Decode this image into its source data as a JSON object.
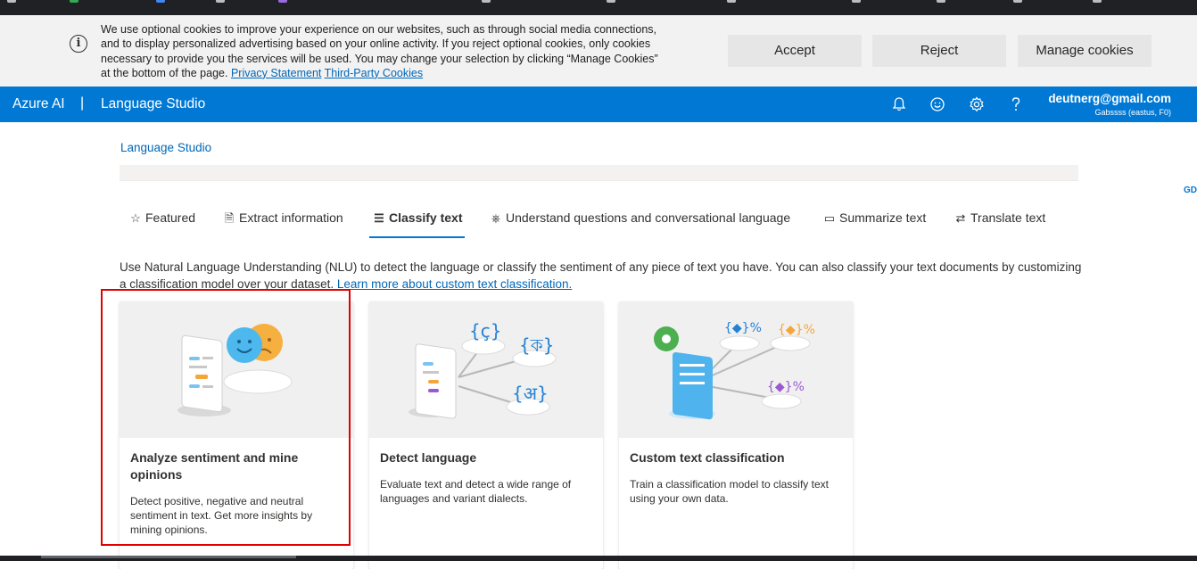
{
  "cookie_banner": {
    "message": "We use optional cookies to improve your experience on our websites, such as through social media connections, and to display personalized advertising based on your online activity. If you reject optional cookies, only cookies necessary to provide you the services will be used. You may change your selection by clicking “Manage Cookies” at the bottom of the page.",
    "privacy_link": "Privacy Statement",
    "third_party_link": "Third-Party Cookies",
    "accept": "Accept",
    "reject": "Reject",
    "manage": "Manage cookies",
    "info_icon": "info-icon"
  },
  "app_bar": {
    "brand": "Azure AI",
    "separator": "|",
    "product": "Language Studio",
    "icons": [
      "bell-icon",
      "smiley-icon",
      "gear-icon",
      "help-icon"
    ],
    "user_email": "deutnerg@gmail.com",
    "user_tenant": "Gabssss (eastus, F0)",
    "avatar_initials": "GD"
  },
  "breadcrumb": "Language Studio",
  "tabs": [
    {
      "label": "Featured",
      "icon": "star-icon"
    },
    {
      "label": "Extract information",
      "icon": "document-icon"
    },
    {
      "label": "Classify text",
      "icon": "list-icon",
      "active": true
    },
    {
      "label": "Understand questions and conversational language",
      "icon": "bot-icon"
    },
    {
      "label": "Summarize text",
      "icon": "summary-icon"
    },
    {
      "label": "Translate text",
      "icon": "translate-icon"
    }
  ],
  "description": {
    "text": "Use Natural Language Understanding (NLU) to detect the language or classify the sentiment of any piece of text you have. You can also classify your text documents by customizing a classification model over your dataset.",
    "link": "Learn more about custom text classification."
  },
  "cards": [
    {
      "title": "Analyze sentiment and mine opinions",
      "description": "Detect positive, negative and neutral sentiment in text. Get more insights by mining opinions.",
      "image": "sentiment-illustration"
    },
    {
      "title": "Detect language",
      "description": "Evaluate text and detect a wide range of languages and variant dialects.",
      "image": "language-illustration",
      "glyphs": [
        "{ç}",
        "{ক}",
        "{अ}"
      ]
    },
    {
      "title": "Custom text classification",
      "description": "Train a classification model to classify text using your own data.",
      "image": "classification-illustration"
    }
  ],
  "colors": {
    "accent": "#0078d4",
    "highlight": "#e00000",
    "link": "#0067b8"
  }
}
